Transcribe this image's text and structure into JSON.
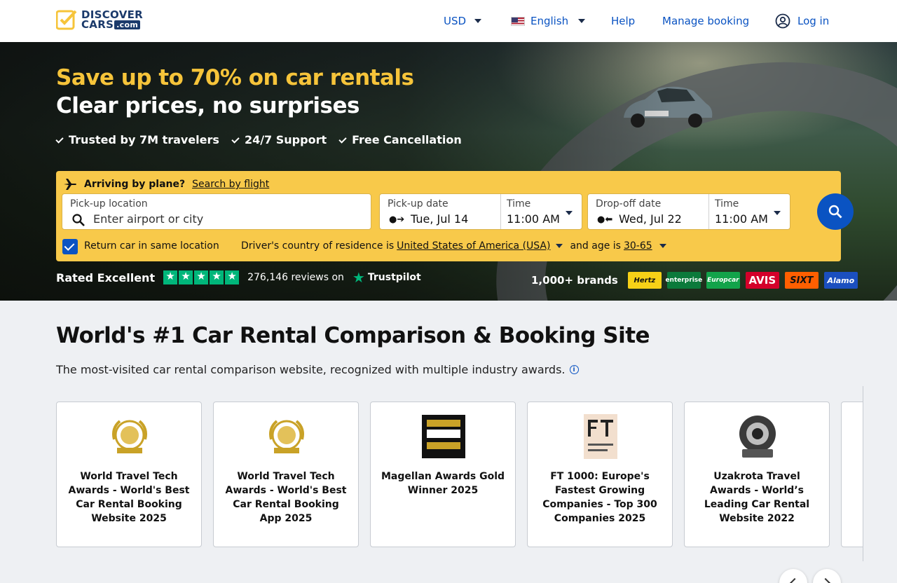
{
  "header": {
    "logo_line1": "DISCOVER",
    "logo_line2": "CARS",
    "logo_suffix": ".com",
    "currency": "USD",
    "language": "English",
    "help": "Help",
    "manage_booking": "Manage booking",
    "login": "Log in"
  },
  "hero": {
    "headline": "Save up to 70% on car rentals",
    "subheadline": "Clear prices, no surprises",
    "usps": [
      "Trusted by 7M travelers",
      "24/7 Support",
      "Free Cancellation"
    ]
  },
  "search": {
    "arriving_label": "Arriving by plane?",
    "search_by_flight": "Search by flight",
    "pickup_location_label": "Pick-up location",
    "pickup_location_placeholder": "Enter airport or city",
    "pickup_date_label": "Pick-up date",
    "pickup_date_value": "Tue, Jul 14",
    "pickup_time_label": "Time",
    "pickup_time_value": "11:00 AM",
    "dropoff_date_label": "Drop-off date",
    "dropoff_date_value": "Wed, Jul 22",
    "dropoff_time_label": "Time",
    "dropoff_time_value": "11:00 AM",
    "return_same_label": "Return car in same location",
    "residence_label": "Driver's country of residence is",
    "residence_value": "United States of America (USA)",
    "age_label": "and age is",
    "age_value": "30-65"
  },
  "rating": {
    "label": "Rated Excellent",
    "reviews": "276,146 reviews on",
    "provider": "Trustpilot"
  },
  "brands": {
    "count": "1,000+ brands",
    "items": [
      {
        "name": "Hertz",
        "bg": "#f7d117",
        "fg": "#111"
      },
      {
        "name": "enterprise",
        "bg": "#0b7a3b",
        "fg": "#fff"
      },
      {
        "name": "Europcar",
        "bg": "#12a34a",
        "fg": "#fff"
      },
      {
        "name": "AVIS",
        "bg": "#d4002a",
        "fg": "#fff"
      },
      {
        "name": "SIXT",
        "bg": "#ff5f00",
        "fg": "#111"
      },
      {
        "name": "Alamo",
        "bg": "#1b4fbf",
        "fg": "#fff"
      }
    ]
  },
  "section": {
    "title": "World's #1 Car Rental Comparison & Booking Site",
    "subtitle": "The most-visited car rental comparison website, recognized with multiple industry awards."
  },
  "awards": [
    {
      "text": "World Travel Tech Awards - World's Best Car Rental Booking Website 2025",
      "icon": "laurel-award-icon"
    },
    {
      "text": "World Travel Tech Awards - World's Best Car Rental Booking App 2025",
      "icon": "laurel-award-icon"
    },
    {
      "text": "Magellan Awards Gold Winner 2025",
      "icon": "magellan-award-icon"
    },
    {
      "text": "FT 1000: Europe's Fastest Growing Companies - Top 300 Companies 2025",
      "icon": "ft-logo-icon"
    },
    {
      "text": "Uzakrota Travel Awards - World’s Leading Car Rental Website 2022",
      "icon": "uzakrota-award-icon"
    }
  ],
  "colors": {
    "accent_yellow": "#f8c94a",
    "headline_yellow": "#f6c43a",
    "primary_blue": "#0a53c2",
    "trustpilot_green": "#00b67a"
  }
}
